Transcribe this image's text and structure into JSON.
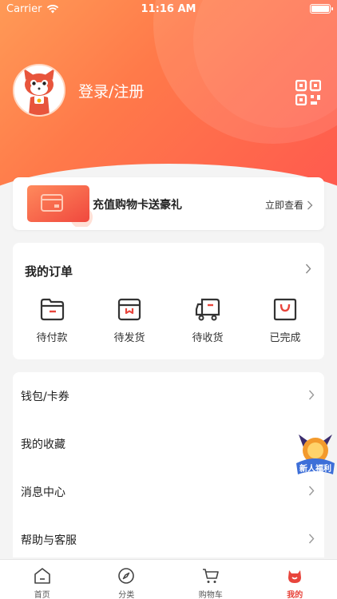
{
  "status_bar": {
    "carrier": "Carrier",
    "time": "11:16 AM"
  },
  "profile": {
    "login_label": "登录/注册",
    "avatar_icon": "fox-mascot-avatar",
    "qr_icon": "qr-code-icon"
  },
  "promo": {
    "title": "充值购物卡送豪礼",
    "link_label": "立即查看"
  },
  "orders": {
    "title": "我的订单",
    "items": [
      {
        "label": "待付款",
        "icon": "wallet-icon"
      },
      {
        "label": "待发货",
        "icon": "package-box-icon"
      },
      {
        "label": "待收货",
        "icon": "delivery-truck-icon"
      },
      {
        "label": "已完成",
        "icon": "shopping-bag-icon"
      }
    ]
  },
  "menu": {
    "items": [
      {
        "label": "钱包/卡券"
      },
      {
        "label": "我的收藏"
      },
      {
        "label": "消息中心"
      },
      {
        "label": "帮助与客服"
      }
    ]
  },
  "float_badge": {
    "label": "新人福利"
  },
  "tabs": [
    {
      "label": "首页",
      "icon": "home-icon",
      "active": false
    },
    {
      "label": "分类",
      "icon": "compass-icon",
      "active": false
    },
    {
      "label": "购物车",
      "icon": "cart-icon",
      "active": false
    },
    {
      "label": "我的",
      "icon": "profile-face-icon",
      "active": true
    }
  ],
  "colors": {
    "accent": "#e8453c",
    "header_gradient_start": "#ff9a56",
    "header_gradient_end": "#ff5a4e"
  }
}
